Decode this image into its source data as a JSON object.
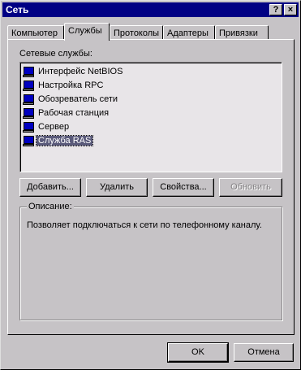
{
  "window": {
    "title": "Сеть"
  },
  "titlebar": {
    "help_label": "?",
    "close_label": "×"
  },
  "tabs": [
    {
      "label": "Компьютер"
    },
    {
      "label": "Службы"
    },
    {
      "label": "Протоколы"
    },
    {
      "label": "Адаптеры"
    },
    {
      "label": "Привязки"
    }
  ],
  "active_tab": "Службы",
  "services": {
    "label": "Сетевые службы:",
    "items": [
      {
        "label": "Интерфейс NetBIOS",
        "icon": "network-service-icon"
      },
      {
        "label": "Настройка RPC",
        "icon": "network-service-icon"
      },
      {
        "label": "Обозреватель сети",
        "icon": "network-service-icon"
      },
      {
        "label": "Рабочая станция",
        "icon": "network-service-icon"
      },
      {
        "label": "Сервер",
        "icon": "network-service-icon"
      },
      {
        "label": "Служба RAS",
        "icon": "network-service-icon"
      }
    ],
    "selected": "Служба RAS"
  },
  "buttons": {
    "add": "Добавить...",
    "remove": "Удалить",
    "properties": "Свойства...",
    "update": "Обновить"
  },
  "description": {
    "label": "Описание:",
    "text": "Позволяет подключаться к сети по телефонному каналу."
  },
  "dialog": {
    "ok": "OK",
    "cancel": "Отмена"
  },
  "colors": {
    "titlebar": "#000084",
    "face": "#c6c3c6",
    "selection": "#5a5a7a",
    "disabled_text": "#848284"
  }
}
